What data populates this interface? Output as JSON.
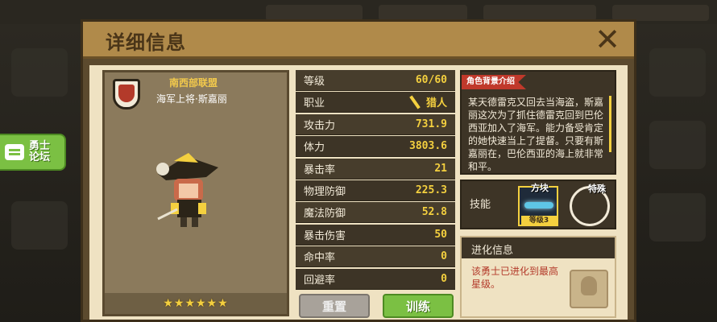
{
  "dialog": {
    "title": "详细信息",
    "close_glyph": "✕"
  },
  "forum_button": {
    "label": "勇士\n论坛"
  },
  "character": {
    "faction": "南西部联盟",
    "name": "海军上将·斯嘉丽",
    "stars": "★★★★★★"
  },
  "stats": [
    {
      "label": "等级",
      "value": "60/60"
    },
    {
      "label": "职业",
      "value": "猎人"
    },
    {
      "label": "攻击力",
      "value": "731.9"
    },
    {
      "label": "体力",
      "value": "3803.6"
    },
    {
      "label": "暴击率",
      "value": "21"
    },
    {
      "label": "物理防御",
      "value": "225.3"
    },
    {
      "label": "魔法防御",
      "value": "52.8"
    },
    {
      "label": "暴击伤害",
      "value": "50"
    },
    {
      "label": "命中率",
      "value": "0"
    },
    {
      "label": "回避率",
      "value": "0"
    }
  ],
  "buttons": {
    "reset": "重置",
    "train": "训练"
  },
  "background_story": {
    "tag": "角色背景介绍",
    "text": "某天德雷克又回去当海盗，斯嘉丽这次为了抓住德雷克回到巴伦西亚加入了海军。能力备受肯定的她快速当上了提督。只要有斯嘉丽在，巴伦西亚的海上就非常和平。"
  },
  "skills": {
    "label": "技能",
    "slots": [
      {
        "type": "方块",
        "level": "等级3"
      },
      {
        "type": "特殊"
      }
    ]
  },
  "evolution": {
    "title": "进化信息",
    "text": "该勇士已进化到最高星级。"
  },
  "colors": {
    "accent_gold": "#f4d03f",
    "train_green": "#7bc043",
    "tag_red": "#c0392b"
  }
}
